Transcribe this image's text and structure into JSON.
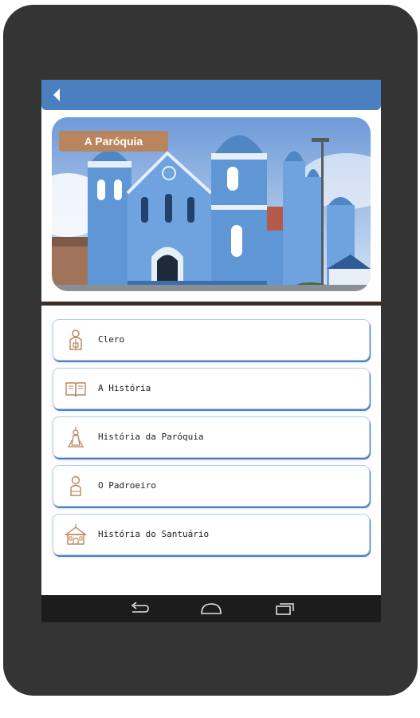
{
  "colors": {
    "device_frame": "#343434",
    "app_bar": "#4a80bf",
    "badge": "#b9855e",
    "divider": "#3d2e25",
    "icon_stroke": "#b9855e",
    "card_border": "#4a80bf",
    "nav_bar": "#1c1c1c"
  },
  "app_bar": {
    "back_icon": "back-arrow-icon"
  },
  "hero": {
    "badge": "A Paróquia",
    "image": "blue church photo"
  },
  "menu": {
    "items": [
      {
        "label": "Clero",
        "icon": "priest-icon"
      },
      {
        "label": "A História",
        "icon": "open-book-icon"
      },
      {
        "label": "História da Paróquia",
        "icon": "saint-statue-icon"
      },
      {
        "label": "O Padroeiro",
        "icon": "patron-saint-icon"
      },
      {
        "label": "História do Santuário",
        "icon": "church-building-icon"
      }
    ]
  },
  "nav_bar": {
    "buttons": [
      {
        "icon": "back-nav-icon"
      },
      {
        "icon": "home-nav-icon"
      },
      {
        "icon": "recents-nav-icon"
      }
    ]
  }
}
